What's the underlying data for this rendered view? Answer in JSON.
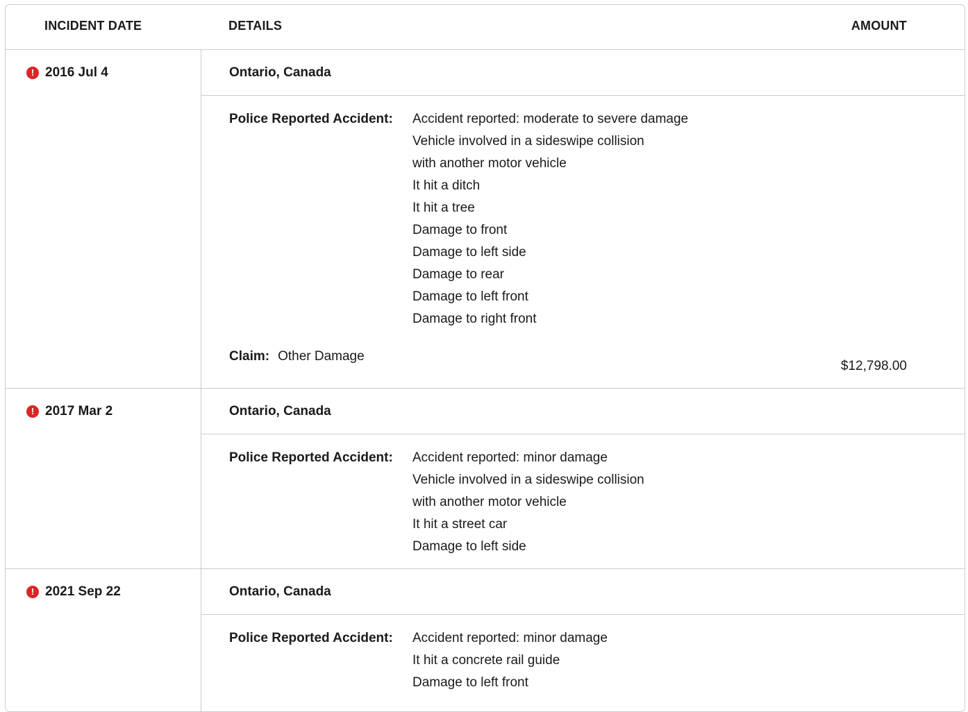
{
  "header": {
    "date_label": "INCIDENT DATE",
    "details_label": "DETAILS",
    "amount_label": "AMOUNT"
  },
  "alert_icon": {
    "glyph": "!",
    "icon": "alert-icon",
    "color": "#dc2626"
  },
  "incidents": [
    {
      "date": "2016 Jul 4",
      "location": "Ontario, Canada",
      "detail_label": "Police Reported Accident:",
      "lines": [
        "Accident reported: moderate to severe damage",
        "Vehicle involved in a sideswipe collision",
        "with another motor vehicle",
        "It hit a ditch",
        "It hit a tree",
        "Damage to front",
        "Damage to left side",
        "Damage to rear",
        "Damage to left front",
        "Damage to right front"
      ],
      "claim_label": "Claim:",
      "claim_value": "Other Damage",
      "amount": "$12,798.00"
    },
    {
      "date": "2017 Mar 2",
      "location": "Ontario, Canada",
      "detail_label": "Police Reported Accident:",
      "lines": [
        "Accident reported: minor damage",
        "Vehicle involved in a sideswipe collision",
        "with another motor vehicle",
        "It hit a street car",
        "Damage to left side"
      ]
    },
    {
      "date": "2021 Sep 22",
      "location": "Ontario, Canada",
      "detail_label": "Police Reported Accident:",
      "lines": [
        "Accident reported: minor damage",
        "It hit a concrete rail guide",
        "Damage to left front"
      ]
    }
  ]
}
